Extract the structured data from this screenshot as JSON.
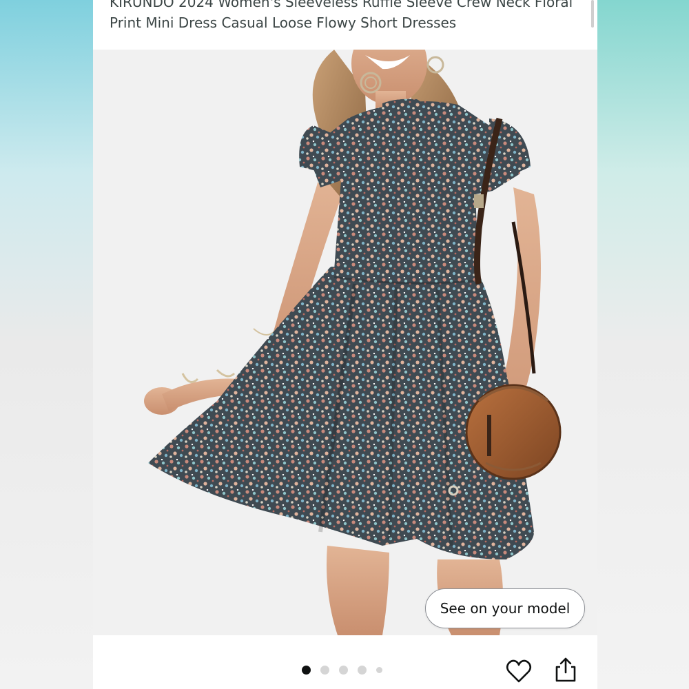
{
  "product": {
    "title": "KIRUNDO 2024 Women's Sleeveless Ruffle Sleeve Crew Neck Floral Print Mini Dress Casual Loose Flowy Short Dresses"
  },
  "gallery": {
    "image_icon": "floral-dress-photo",
    "see_on_model_label": "See on your model",
    "page_count": 5,
    "active_page": 1
  },
  "actions": {
    "favorite_icon": "heart-icon",
    "share_icon": "share-icon"
  },
  "colors": {
    "bg_teal": "#8fd3de",
    "dot_active": "#0f1111",
    "dot_inactive": "#d5d5d5",
    "button_border": "#8d9096"
  }
}
